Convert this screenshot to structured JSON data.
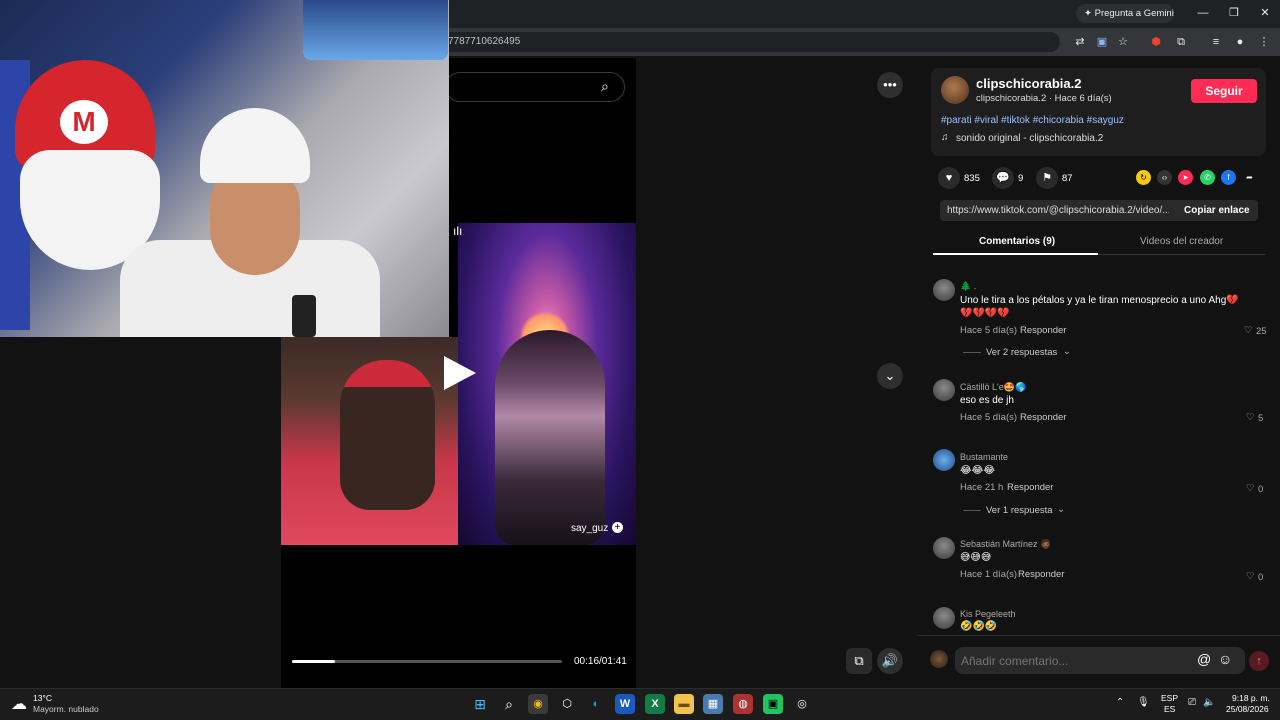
{
  "browser": {
    "url_fragment": "7787710626495",
    "gemini_button": "Pregunta a Gemini"
  },
  "video": {
    "search_placeholder": "",
    "overlay_username": "say_guz",
    "time": "00:16/01:41",
    "progress": 0.159
  },
  "post": {
    "username": "clipschicorabia.2",
    "subline": "clipschicorabia.2 · Hace 6 día(s)",
    "follow_label": "Seguir",
    "hashtags": "#parati #viral #tiktok #chicorabia #sayguz",
    "sound": "sonido original - clipschicorabia.2",
    "likes": "835",
    "comments": "9",
    "saves": "87",
    "link": "https://www.tiktok.com/@clipschicorabia.2/video/...",
    "copy_label": "Copiar enlace"
  },
  "tabs": {
    "comments": "Comentarios (9)",
    "creator_videos": "Videos del creador"
  },
  "comments": [
    {
      "user": "🌲 .",
      "text": "Uno le tira a los pétalos y ya le tiran menosprecio a uno Ahg💔💔💔💔💔",
      "time": "Hace 5 día(s)",
      "reply": "Responder",
      "likes": "25",
      "replies": "Ver 2 respuestas"
    },
    {
      "user": "Cästillö L'e🤩🌎",
      "text": "eso es de jh",
      "time": "Hace 5 día(s)",
      "reply": "Responder",
      "likes": "5"
    },
    {
      "user": "Bustamante",
      "text": "😂😂😂",
      "time": "Hace 21 h",
      "reply": "Responder",
      "likes": "0",
      "replies": "Ver 1 respuesta"
    },
    {
      "user": "Sebastián Martínez 🧔🏾",
      "text": "😅😅😅",
      "time": "Hace 1 día(s)",
      "reply": "Responder",
      "likes": "0"
    },
    {
      "user": "Kis Pegeleeth",
      "text": "🤣🤣🤣",
      "time": "",
      "reply": "",
      "likes": ""
    }
  ],
  "comment_input": {
    "placeholder": "Añadir comentario..."
  },
  "taskbar": {
    "weather_temp": "13°C",
    "weather_desc": "Mayorm. nublado",
    "lang_top": "ESP",
    "lang_bottom": "ES",
    "time": "9:18 p. m.",
    "date": "25/08/2026"
  }
}
